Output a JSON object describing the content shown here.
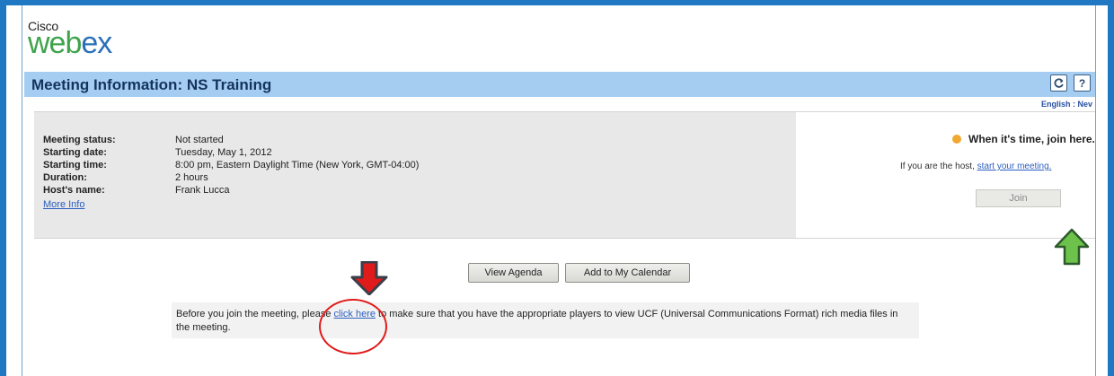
{
  "logo": {
    "cisco": "Cisco",
    "webex_we": "web",
    "webex_ex": "ex"
  },
  "header": {
    "title": "Meeting Information: NS Training",
    "lang": "English : Nev"
  },
  "meeting": {
    "rows": [
      {
        "label": "Meeting status:",
        "value": "Not started"
      },
      {
        "label": "Starting date:",
        "value": "Tuesday, May 1, 2012"
      },
      {
        "label": "Starting time:",
        "value": "8:00 pm, Eastern Daylight Time (New York, GMT-04:00)"
      },
      {
        "label": "Duration:",
        "value": "2 hours"
      },
      {
        "label": "Host's name:",
        "value": "Frank Lucca"
      }
    ],
    "more_info": "More Info"
  },
  "join": {
    "heading": "When it's time, join here.",
    "host_prefix": "If you are the host,",
    "host_link": "start your meeting.",
    "join_label": "Join"
  },
  "actions": {
    "agenda_label": "View Agenda",
    "calendar_label": "Add to My Calendar"
  },
  "notice": {
    "before": "Before you join the meeting, please ",
    "link": "click here",
    "after": " to make sure that you have the appropriate players to view UCF (Universal Communications Format) rich media files in the meeting."
  },
  "icons": {
    "refresh": "refresh-icon",
    "help": "help-icon",
    "help_glyph": "?"
  },
  "colors": {
    "frame": "#1f78c1",
    "titlebar": "#a5cdf2",
    "annotation_red": "#e01b1b",
    "annotation_green": "#6cc24a"
  }
}
